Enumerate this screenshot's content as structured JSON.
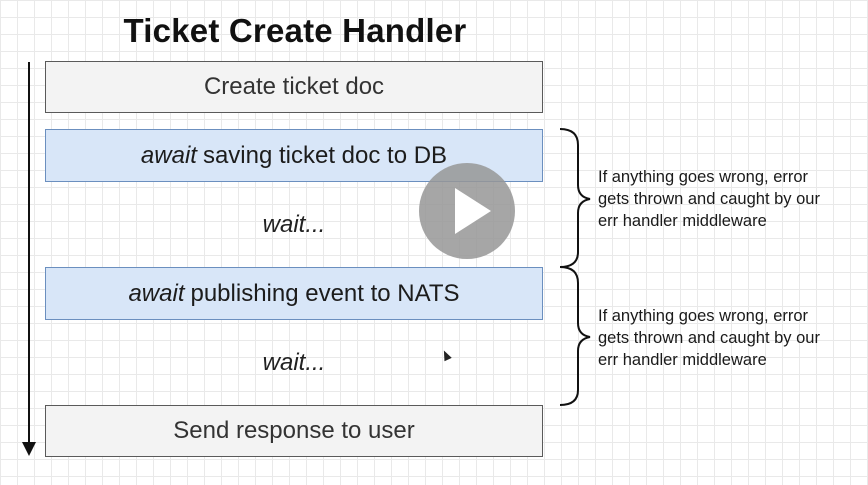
{
  "title": "Ticket Create Handler",
  "steps": {
    "create": "Create ticket doc",
    "save_await": "await",
    "save_text": "saving ticket doc to DB",
    "wait1": "wait...",
    "publish_await": "await",
    "publish_text": "publishing event to NATS",
    "wait2": "wait...",
    "send": "Send response to user"
  },
  "notes": {
    "first": {
      "line1": "If anything goes wrong, error",
      "line2": "gets thrown and caught by our",
      "line3": "err handler middleware"
    },
    "second": {
      "line1": "If anything goes wrong, error",
      "line2": "gets thrown and caught by our",
      "line3": "err handler middleware"
    }
  },
  "icons": {
    "play": "play-icon",
    "arrow": "timeline-arrow",
    "cursor": "mouse-cursor-icon"
  },
  "colors": {
    "gray_box": "#f3f3f3",
    "blue_box": "#d8e6f8",
    "play_button": "#969696"
  }
}
